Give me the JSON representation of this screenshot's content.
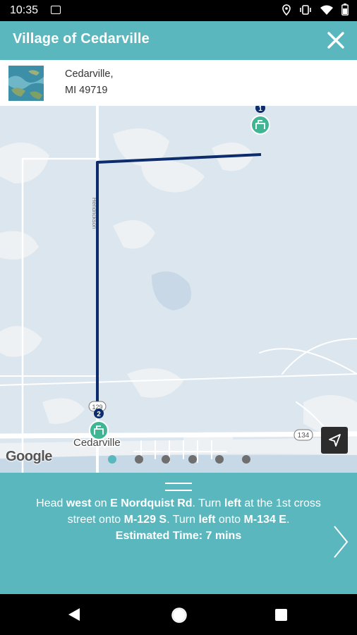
{
  "status_bar": {
    "time": "10:35",
    "icons": [
      "image-icon",
      "location-icon",
      "vibrate-icon",
      "wifi-icon",
      "battery-icon"
    ]
  },
  "app_bar": {
    "title": "Village of Cedarville",
    "close_icon": "close-icon",
    "background": "#5ab7bd"
  },
  "location": {
    "address_line1": "Cedarville,",
    "address_line2": "MI 49719"
  },
  "map": {
    "street_label": "Hendrickson",
    "town_label": "Cedarville",
    "route_shields": [
      "129",
      "134"
    ],
    "stop_markers": [
      "1",
      "2"
    ],
    "attribution": "Google",
    "route_color": "#0d2c6c",
    "marker_color": "#3fb594"
  },
  "pager": {
    "count": 6,
    "active_index": 0
  },
  "directions": {
    "t1": "Head ",
    "b1": "west",
    "t2": " on ",
    "b2": "E Nordquist Rd",
    "t3": ". Turn ",
    "b3": "left",
    "t4": " at the 1st cross street onto ",
    "b4": "M-129 S",
    "t5": ". Turn ",
    "b5": "left",
    "t6": " onto ",
    "b6": "M-134 E",
    "t7": ".",
    "estimate": "Estimated Time: 7 mins"
  },
  "nav_bar": {
    "buttons": [
      "back",
      "home",
      "recents"
    ]
  }
}
